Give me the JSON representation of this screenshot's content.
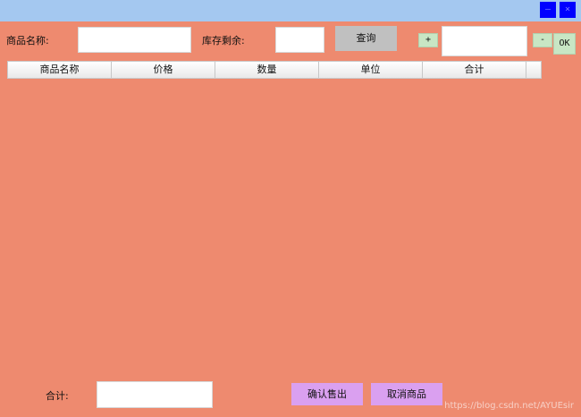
{
  "window": {
    "minimize_icon": "minimize-icon",
    "close_icon": "close-icon",
    "minimize_glyph": "—",
    "close_glyph": "×"
  },
  "form": {
    "name_label": "商品名称:",
    "name_value": "",
    "stock_label": "库存剩余:",
    "stock_value": "",
    "query_button": "查询",
    "plus_button": "+",
    "quantity_value": "",
    "minus_button": "-",
    "ok_button": "OK"
  },
  "table": {
    "headers": [
      "商品名称",
      "价格",
      "数量",
      "单位",
      "合计"
    ],
    "rows": []
  },
  "footer": {
    "total_label": "合计:",
    "total_value": "",
    "confirm_button": "确认售出",
    "cancel_button": "取消商品"
  },
  "watermark": "https://blog.csdn.net/AYUEsir",
  "colors": {
    "background": "#EE8A6F",
    "titlebar": "#A4C8F0",
    "window_buttons": "#0000FF",
    "query_button": "#C0C0C0",
    "qty_buttons": "#C8E6C4",
    "action_buttons": "#DAA0F0"
  }
}
